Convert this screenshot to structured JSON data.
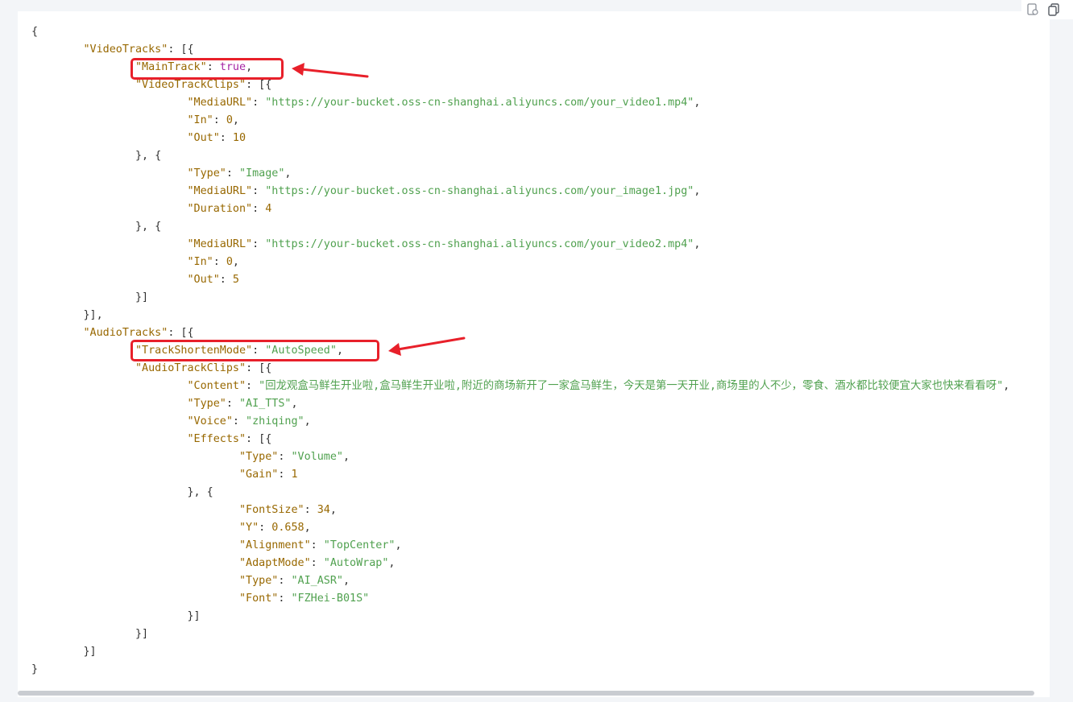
{
  "toolbar": {
    "icons": [
      "copy-doc-icon",
      "copy-icon"
    ]
  },
  "code_lines": [
    [
      [
        "p",
        "{"
      ]
    ],
    [
      [
        "p",
        "        "
      ],
      [
        "k",
        "\"VideoTracks\""
      ],
      [
        "p",
        ": [{"
      ]
    ],
    [
      [
        "p",
        "                "
      ],
      [
        "k",
        "\"MainTrack\""
      ],
      [
        "p",
        ": "
      ],
      [
        "b",
        "true"
      ],
      [
        "p",
        ","
      ]
    ],
    [
      [
        "p",
        "                "
      ],
      [
        "k",
        "\"VideoTrackClips\""
      ],
      [
        "p",
        ": [{"
      ]
    ],
    [
      [
        "p",
        "                        "
      ],
      [
        "k",
        "\"MediaURL\""
      ],
      [
        "p",
        ": "
      ],
      [
        "s",
        "\"https://your-bucket.oss-cn-shanghai.aliyuncs.com/your_video1.mp4\""
      ],
      [
        "p",
        ","
      ]
    ],
    [
      [
        "p",
        "                        "
      ],
      [
        "k",
        "\"In\""
      ],
      [
        "p",
        ": "
      ],
      [
        "n",
        "0"
      ],
      [
        "p",
        ","
      ]
    ],
    [
      [
        "p",
        "                        "
      ],
      [
        "k",
        "\"Out\""
      ],
      [
        "p",
        ": "
      ],
      [
        "n",
        "10"
      ]
    ],
    [
      [
        "p",
        "                }, {"
      ]
    ],
    [
      [
        "p",
        "                        "
      ],
      [
        "k",
        "\"Type\""
      ],
      [
        "p",
        ": "
      ],
      [
        "s",
        "\"Image\""
      ],
      [
        "p",
        ","
      ]
    ],
    [
      [
        "p",
        "                        "
      ],
      [
        "k",
        "\"MediaURL\""
      ],
      [
        "p",
        ": "
      ],
      [
        "s",
        "\"https://your-bucket.oss-cn-shanghai.aliyuncs.com/your_image1.jpg\""
      ],
      [
        "p",
        ","
      ]
    ],
    [
      [
        "p",
        "                        "
      ],
      [
        "k",
        "\"Duration\""
      ],
      [
        "p",
        ": "
      ],
      [
        "n",
        "4"
      ]
    ],
    [
      [
        "p",
        "                }, {"
      ]
    ],
    [
      [
        "p",
        "                        "
      ],
      [
        "k",
        "\"MediaURL\""
      ],
      [
        "p",
        ": "
      ],
      [
        "s",
        "\"https://your-bucket.oss-cn-shanghai.aliyuncs.com/your_video2.mp4\""
      ],
      [
        "p",
        ","
      ]
    ],
    [
      [
        "p",
        "                        "
      ],
      [
        "k",
        "\"In\""
      ],
      [
        "p",
        ": "
      ],
      [
        "n",
        "0"
      ],
      [
        "p",
        ","
      ]
    ],
    [
      [
        "p",
        "                        "
      ],
      [
        "k",
        "\"Out\""
      ],
      [
        "p",
        ": "
      ],
      [
        "n",
        "5"
      ]
    ],
    [
      [
        "p",
        "                }]"
      ]
    ],
    [
      [
        "p",
        "        }],"
      ]
    ],
    [
      [
        "p",
        "        "
      ],
      [
        "k",
        "\"AudioTracks\""
      ],
      [
        "p",
        ": [{"
      ]
    ],
    [
      [
        "p",
        "                "
      ],
      [
        "k",
        "\"TrackShortenMode\""
      ],
      [
        "p",
        ": "
      ],
      [
        "s",
        "\"AutoSpeed\""
      ],
      [
        "p",
        ","
      ]
    ],
    [
      [
        "p",
        "                "
      ],
      [
        "k",
        "\"AudioTrackClips\""
      ],
      [
        "p",
        ": [{"
      ]
    ],
    [
      [
        "p",
        "                        "
      ],
      [
        "k",
        "\"Content\""
      ],
      [
        "p",
        ": "
      ],
      [
        "s",
        "\"回龙观盒马鲜生开业啦,盒马鲜生开业啦,附近的商场新开了一家盒马鲜生，今天是第一天开业,商场里的人不少，零食、酒水都比较便宜大家也快来看看呀\""
      ],
      [
        "p",
        ","
      ]
    ],
    [
      [
        "p",
        "                        "
      ],
      [
        "k",
        "\"Type\""
      ],
      [
        "p",
        ": "
      ],
      [
        "s",
        "\"AI_TTS\""
      ],
      [
        "p",
        ","
      ]
    ],
    [
      [
        "p",
        "                        "
      ],
      [
        "k",
        "\"Voice\""
      ],
      [
        "p",
        ": "
      ],
      [
        "s",
        "\"zhiqing\""
      ],
      [
        "p",
        ","
      ]
    ],
    [
      [
        "p",
        "                        "
      ],
      [
        "k",
        "\"Effects\""
      ],
      [
        "p",
        ": [{"
      ]
    ],
    [
      [
        "p",
        "                                "
      ],
      [
        "k",
        "\"Type\""
      ],
      [
        "p",
        ": "
      ],
      [
        "s",
        "\"Volume\""
      ],
      [
        "p",
        ","
      ]
    ],
    [
      [
        "p",
        "                                "
      ],
      [
        "k",
        "\"Gain\""
      ],
      [
        "p",
        ": "
      ],
      [
        "n",
        "1"
      ]
    ],
    [
      [
        "p",
        "                        }, {"
      ]
    ],
    [
      [
        "p",
        "                                "
      ],
      [
        "k",
        "\"FontSize\""
      ],
      [
        "p",
        ": "
      ],
      [
        "n",
        "34"
      ],
      [
        "p",
        ","
      ]
    ],
    [
      [
        "p",
        "                                "
      ],
      [
        "k",
        "\"Y\""
      ],
      [
        "p",
        ": "
      ],
      [
        "n",
        "0.658"
      ],
      [
        "p",
        ","
      ]
    ],
    [
      [
        "p",
        "                                "
      ],
      [
        "k",
        "\"Alignment\""
      ],
      [
        "p",
        ": "
      ],
      [
        "s",
        "\"TopCenter\""
      ],
      [
        "p",
        ","
      ]
    ],
    [
      [
        "p",
        "                                "
      ],
      [
        "k",
        "\"AdaptMode\""
      ],
      [
        "p",
        ": "
      ],
      [
        "s",
        "\"AutoWrap\""
      ],
      [
        "p",
        ","
      ]
    ],
    [
      [
        "p",
        "                                "
      ],
      [
        "k",
        "\"Type\""
      ],
      [
        "p",
        ": "
      ],
      [
        "s",
        "\"AI_ASR\""
      ],
      [
        "p",
        ","
      ]
    ],
    [
      [
        "p",
        "                                "
      ],
      [
        "k",
        "\"Font\""
      ],
      [
        "p",
        ": "
      ],
      [
        "s",
        "\"FZHei-B01S\""
      ]
    ],
    [
      [
        "p",
        "                        }]"
      ]
    ],
    [
      [
        "p",
        "                }]"
      ]
    ],
    [
      [
        "p",
        "        }]"
      ]
    ],
    [
      [
        "p",
        "}"
      ]
    ]
  ],
  "colors": {
    "key": "#986801",
    "string": "#50a14f",
    "number": "#986801",
    "boolean": "#a626a4",
    "punct": "#333333",
    "highlight": "#e8202a"
  }
}
